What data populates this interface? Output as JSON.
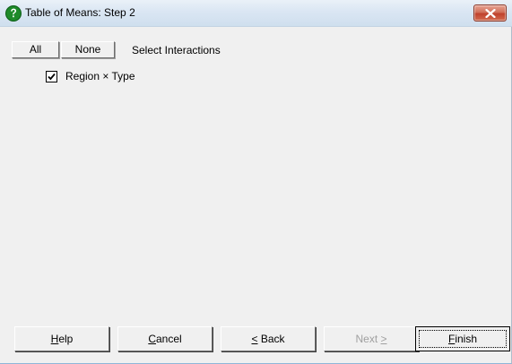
{
  "window": {
    "title": "Table of Means: Step 2",
    "icon": "help-question-icon",
    "accent": "#d0705a"
  },
  "toolbar": {
    "all_label": "All",
    "none_label": "None",
    "heading": "Select Interactions"
  },
  "interactions": [
    {
      "label": "Region × Type",
      "checked": true
    }
  ],
  "buttons": {
    "help": {
      "mnemonic": "H",
      "rest": "elp"
    },
    "cancel": {
      "mnemonic": "C",
      "rest": "ancel"
    },
    "back": {
      "mnemonic": "<",
      "rest": " Back"
    },
    "next": {
      "prefix": "Next ",
      "mnemonic": ">"
    },
    "finish": {
      "mnemonic": "F",
      "rest": "inish"
    }
  }
}
